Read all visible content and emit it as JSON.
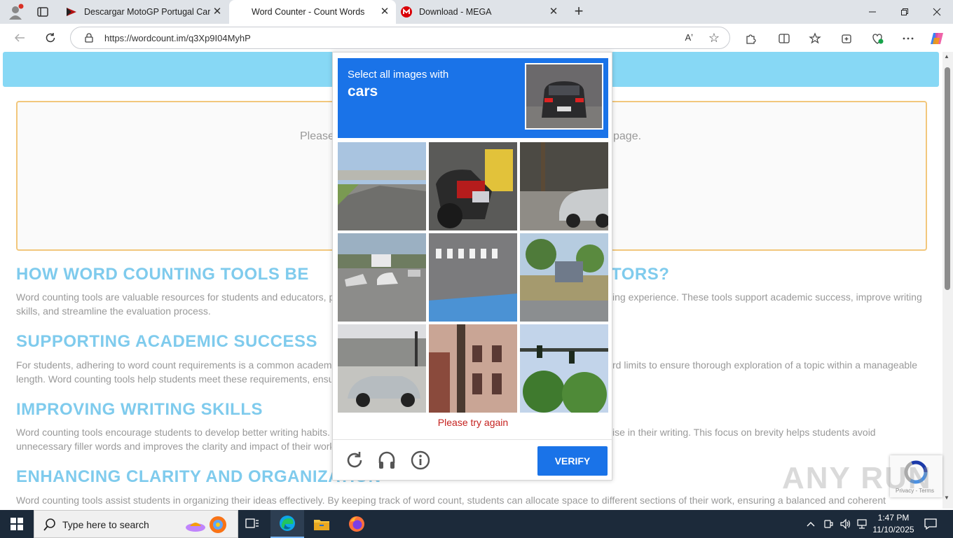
{
  "browser": {
    "tabs": [
      {
        "label": "Descargar MotoGP Portugal Carre",
        "active": false
      },
      {
        "label": "Word Counter - Count Words",
        "active": true
      },
      {
        "label": "Download - MEGA",
        "active": false
      }
    ],
    "url": "https://wordcount.im/q3Xp9I04MyhP",
    "read_aloud_label": "Aʼ"
  },
  "page": {
    "textarea_placeholder_left": "Please",
    "textarea_placeholder_right": "page.",
    "sections": [
      {
        "heading": "HOW WORD COUNTING TOOLS BE",
        "heading_tail": "TORS?",
        "text_left": "Word counting tools are valuable resources for students and educators, p",
        "text_right": "ing experience. These tools support academic success, improve writing",
        "text_line2": "skills, and streamline the evaluation process."
      },
      {
        "heading": "SUPPORTING ACADEMIC SUCCESS",
        "text_left": "For students, adhering to word count requirements is a common academ",
        "text_right": "rd limits to ensure thorough exploration of a topic within a manageable",
        "text_line2": "length. Word counting tools help students meet these requirements, ensu"
      },
      {
        "heading": "IMPROVING WRITING SKILLS",
        "text_left": "Word counting tools encourage students to develop better writing habits.",
        "text_right": "ise in their writing. This focus on brevity helps students avoid",
        "text_line2": "unnecessary filler words and improves the clarity and impact of their work"
      },
      {
        "heading": "ENHANCING CLARITY AND ORGANIZATION",
        "text_left": "Word counting tools assist students in organizing their ideas effectively. By keeping track of word count, students can allocate space to different sections of their work, ensuring a balanced and coherent"
      }
    ]
  },
  "captcha": {
    "instruction": "Select all images with",
    "target": "cars",
    "error": "Please try again",
    "verify_label": "VERIFY",
    "tiles": [
      "highway-overpass",
      "motorcycle-closeup",
      "parked-silver-car",
      "street-traffic",
      "crosswalk",
      "roadside-market",
      "silver-prius",
      "building-facade",
      "traffic-lights-trees"
    ]
  },
  "recaptcha_badge": {
    "terms": "Privacy - Terms"
  },
  "watermark": "ANY RUN",
  "taskbar": {
    "search_placeholder": "Type here to search",
    "time": "1:47 PM",
    "date": "11/10/2025"
  }
}
